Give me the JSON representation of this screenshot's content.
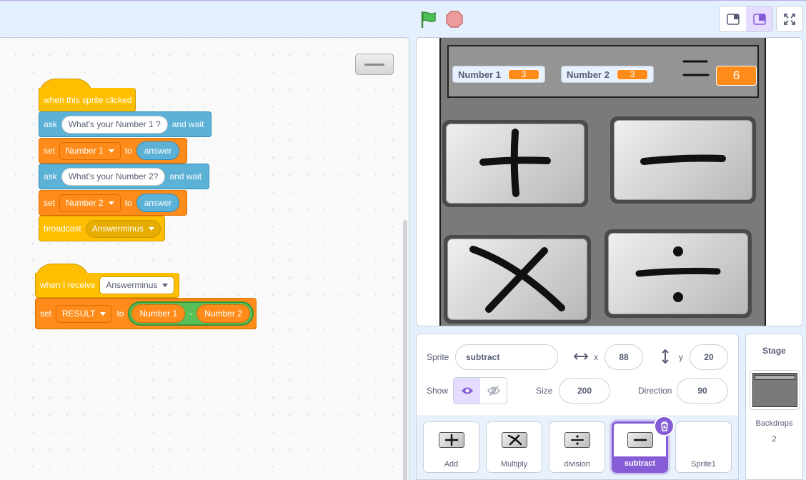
{
  "topbar": {
    "green_flag": "green-flag",
    "stop": "stop-sign",
    "modes": [
      "small-stage-mode",
      "normal-stage-mode"
    ],
    "fullscreen": "fullscreen"
  },
  "script1": {
    "hat": "when this sprite clicked",
    "ask1_label": "ask",
    "ask1_question": "What's your Number 1 ?",
    "ask1_suffix": "and wait",
    "set1_label": "set",
    "set1_var": "Number 1",
    "set1_to": "to",
    "set1_value": "answer",
    "ask2_label": "ask",
    "ask2_question": "What's your Number 2?",
    "ask2_suffix": "and wait",
    "set2_label": "set",
    "set2_var": "Number 2",
    "set2_to": "to",
    "set2_value": "answer",
    "broadcast_label": "broadcast",
    "broadcast_msg": "Answerminus"
  },
  "script2": {
    "hat_label": "when I receive",
    "hat_msg": "Answerminus",
    "set_label": "set",
    "set_var": "RESULT",
    "set_to": "to",
    "op_left": "Number 1",
    "op_symbol": "-",
    "op_right": "Number 2"
  },
  "stage": {
    "monitor1_label": "Number 1",
    "monitor1_value": "3",
    "monitor2_label": "Number 2",
    "monitor2_value": "3",
    "result_value": "6"
  },
  "sprite_info": {
    "sprite_label": "Sprite",
    "sprite_name": "subtract",
    "x_label": "x",
    "x_value": "88",
    "y_label": "y",
    "y_value": "20",
    "show_label": "Show",
    "size_label": "Size",
    "size_value": "200",
    "direction_label": "Direction",
    "direction_value": "90"
  },
  "sprites": [
    {
      "name": "Add",
      "icon": "plus"
    },
    {
      "name": "Multiply",
      "icon": "times"
    },
    {
      "name": "division",
      "icon": "divide"
    },
    {
      "name": "subtract",
      "icon": "minus"
    },
    {
      "name": "Sprite1",
      "icon": ""
    }
  ],
  "stage_panel": {
    "title": "Stage",
    "backdrops_label": "Backdrops",
    "backdrops_count": "2"
  },
  "colors": {
    "events": "#ffbf00",
    "sensing": "#5cb1d6",
    "variables": "#ff8c1a",
    "operators": "#59c059",
    "accent": "#855cd6"
  }
}
